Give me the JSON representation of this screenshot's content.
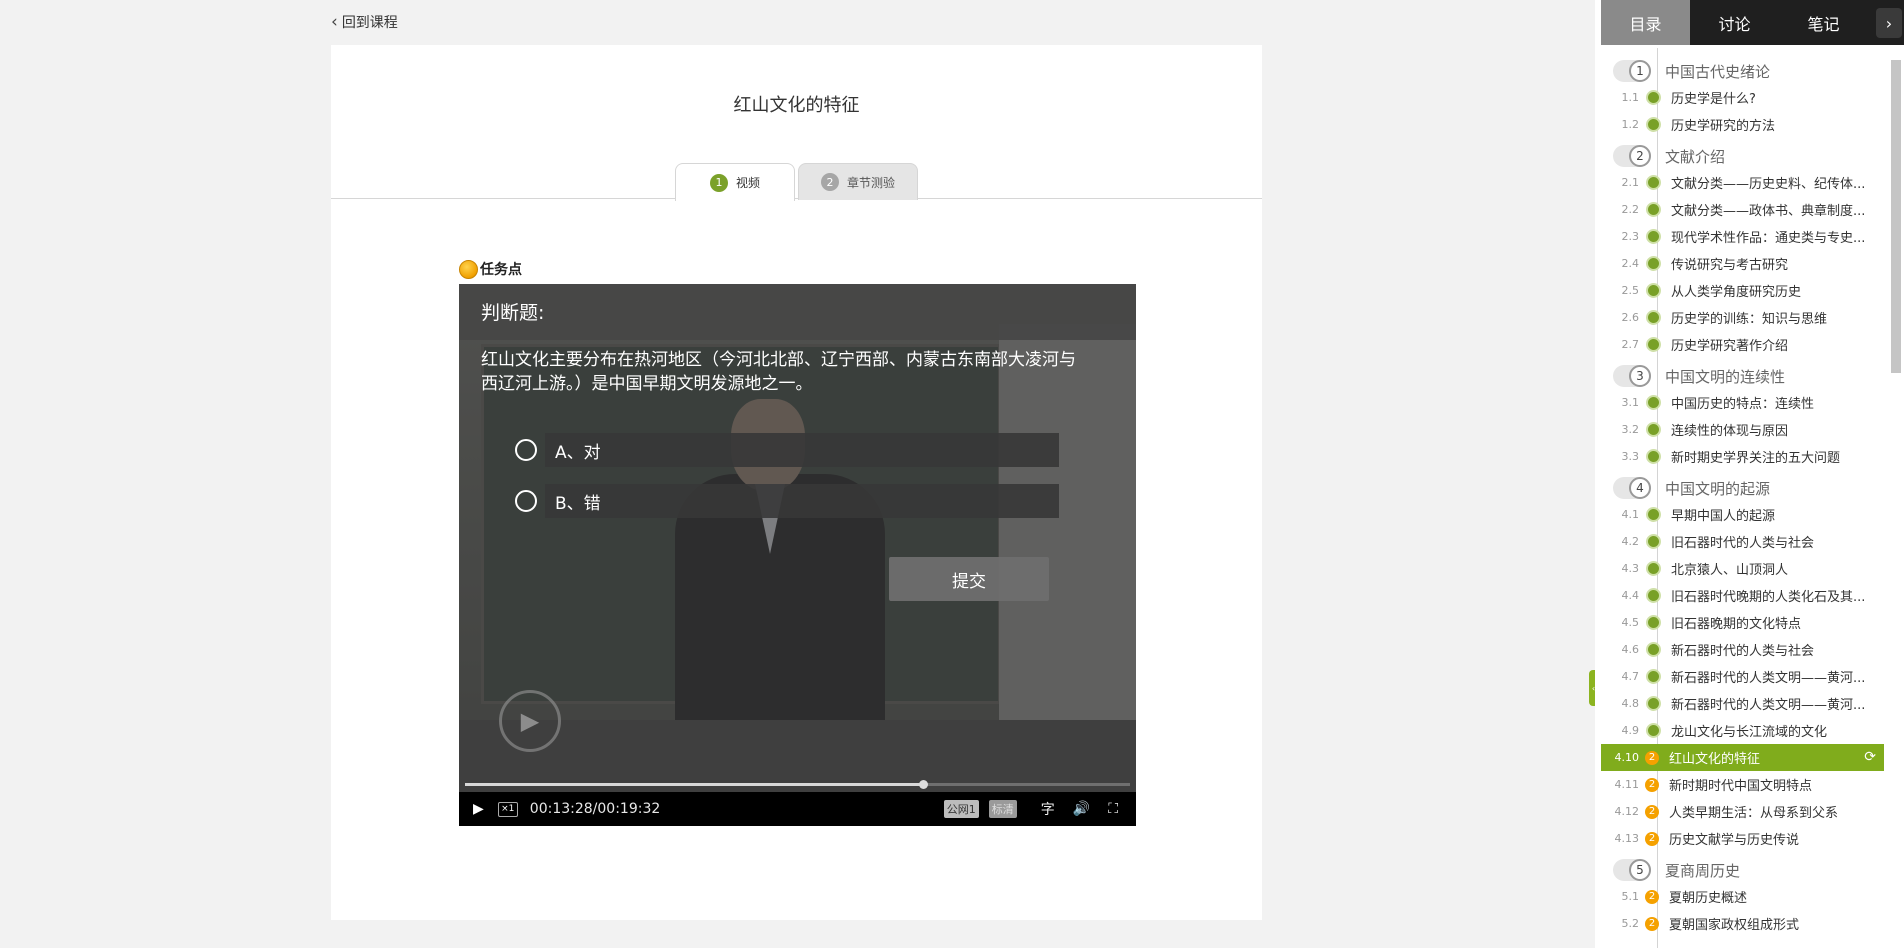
{
  "back_link": "回到课程",
  "lesson": {
    "title": "红山文化的特征"
  },
  "tabs": [
    {
      "num": "1",
      "label": "视频"
    },
    {
      "num": "2",
      "label": "章节测验"
    }
  ],
  "task_point": "任务点",
  "question": {
    "type": "判断题:",
    "text": "红山文化主要分布在热河地区（今河北北部、辽宁西部、内蒙古东南部大凌河与西辽河上游。）是中国早期文明发源地之一。",
    "options": [
      {
        "label": "A、对"
      },
      {
        "label": "B、错"
      }
    ],
    "submit": "提交"
  },
  "player": {
    "speed": "×1",
    "time": "00:13:28/00:19:32",
    "progress": 0.689,
    "line": "公网1",
    "quality": "标清",
    "subtitle": "字"
  },
  "sidebar": {
    "tabs": [
      "目录",
      "讨论",
      "笔记"
    ],
    "active_tab": 0,
    "chapters": [
      {
        "num": "1",
        "title": "中国古代史绪论",
        "sections": [
          {
            "num": "1.1",
            "title": "历史学是什么?",
            "status": "done"
          },
          {
            "num": "1.2",
            "title": "历史学研究的方法",
            "status": "done"
          }
        ]
      },
      {
        "num": "2",
        "title": "文献介绍",
        "sections": [
          {
            "num": "2.1",
            "title": "文献分类——历史史料、纪传体...",
            "status": "done"
          },
          {
            "num": "2.2",
            "title": "文献分类——政体书、典章制度...",
            "status": "done"
          },
          {
            "num": "2.3",
            "title": "现代学术性作品：通史类与专史...",
            "status": "done"
          },
          {
            "num": "2.4",
            "title": "传说研究与考古研究",
            "status": "done"
          },
          {
            "num": "2.5",
            "title": "从人类学角度研究历史",
            "status": "done"
          },
          {
            "num": "2.6",
            "title": "历史学的训练：知识与思维",
            "status": "done"
          },
          {
            "num": "2.7",
            "title": "历史学研究著作介绍",
            "status": "done"
          }
        ]
      },
      {
        "num": "3",
        "title": "中国文明的连续性",
        "sections": [
          {
            "num": "3.1",
            "title": "中国历史的特点：连续性",
            "status": "done"
          },
          {
            "num": "3.2",
            "title": "连续性的体现与原因",
            "status": "done"
          },
          {
            "num": "3.3",
            "title": "新时期史学界关注的五大问题",
            "status": "done"
          }
        ]
      },
      {
        "num": "4",
        "title": "中国文明的起源",
        "sections": [
          {
            "num": "4.1",
            "title": "早期中国人的起源",
            "status": "done"
          },
          {
            "num": "4.2",
            "title": "旧石器时代的人类与社会",
            "status": "done"
          },
          {
            "num": "4.3",
            "title": "北京猿人、山顶洞人",
            "status": "done"
          },
          {
            "num": "4.4",
            "title": "旧石器时代晚期的人类化石及其...",
            "status": "done"
          },
          {
            "num": "4.5",
            "title": "旧石器晚期的文化特点",
            "status": "done"
          },
          {
            "num": "4.6",
            "title": "新石器时代的人类与社会",
            "status": "done"
          },
          {
            "num": "4.7",
            "title": "新石器时代的人类文明——黄河...",
            "status": "done"
          },
          {
            "num": "4.8",
            "title": "新石器时代的人类文明——黄河...",
            "status": "done"
          },
          {
            "num": "4.9",
            "title": "龙山文化与长江流域的文化",
            "status": "done"
          },
          {
            "num": "4.10",
            "title": "红山文化的特征",
            "status": "pending",
            "badge": "2",
            "current": true
          },
          {
            "num": "4.11",
            "title": "新时期时代中国文明特点",
            "status": "pending",
            "badge": "2"
          },
          {
            "num": "4.12",
            "title": "人类早期生活：从母系到父系",
            "status": "pending",
            "badge": "2"
          },
          {
            "num": "4.13",
            "title": "历史文献学与历史传说",
            "status": "pending",
            "badge": "2"
          }
        ]
      },
      {
        "num": "5",
        "title": "夏商周历史",
        "sections": [
          {
            "num": "5.1",
            "title": "夏朝历史概述",
            "status": "pending",
            "badge": "2"
          },
          {
            "num": "5.2",
            "title": "夏朝国家政权组成形式",
            "status": "pending",
            "badge": "2"
          }
        ]
      }
    ]
  }
}
